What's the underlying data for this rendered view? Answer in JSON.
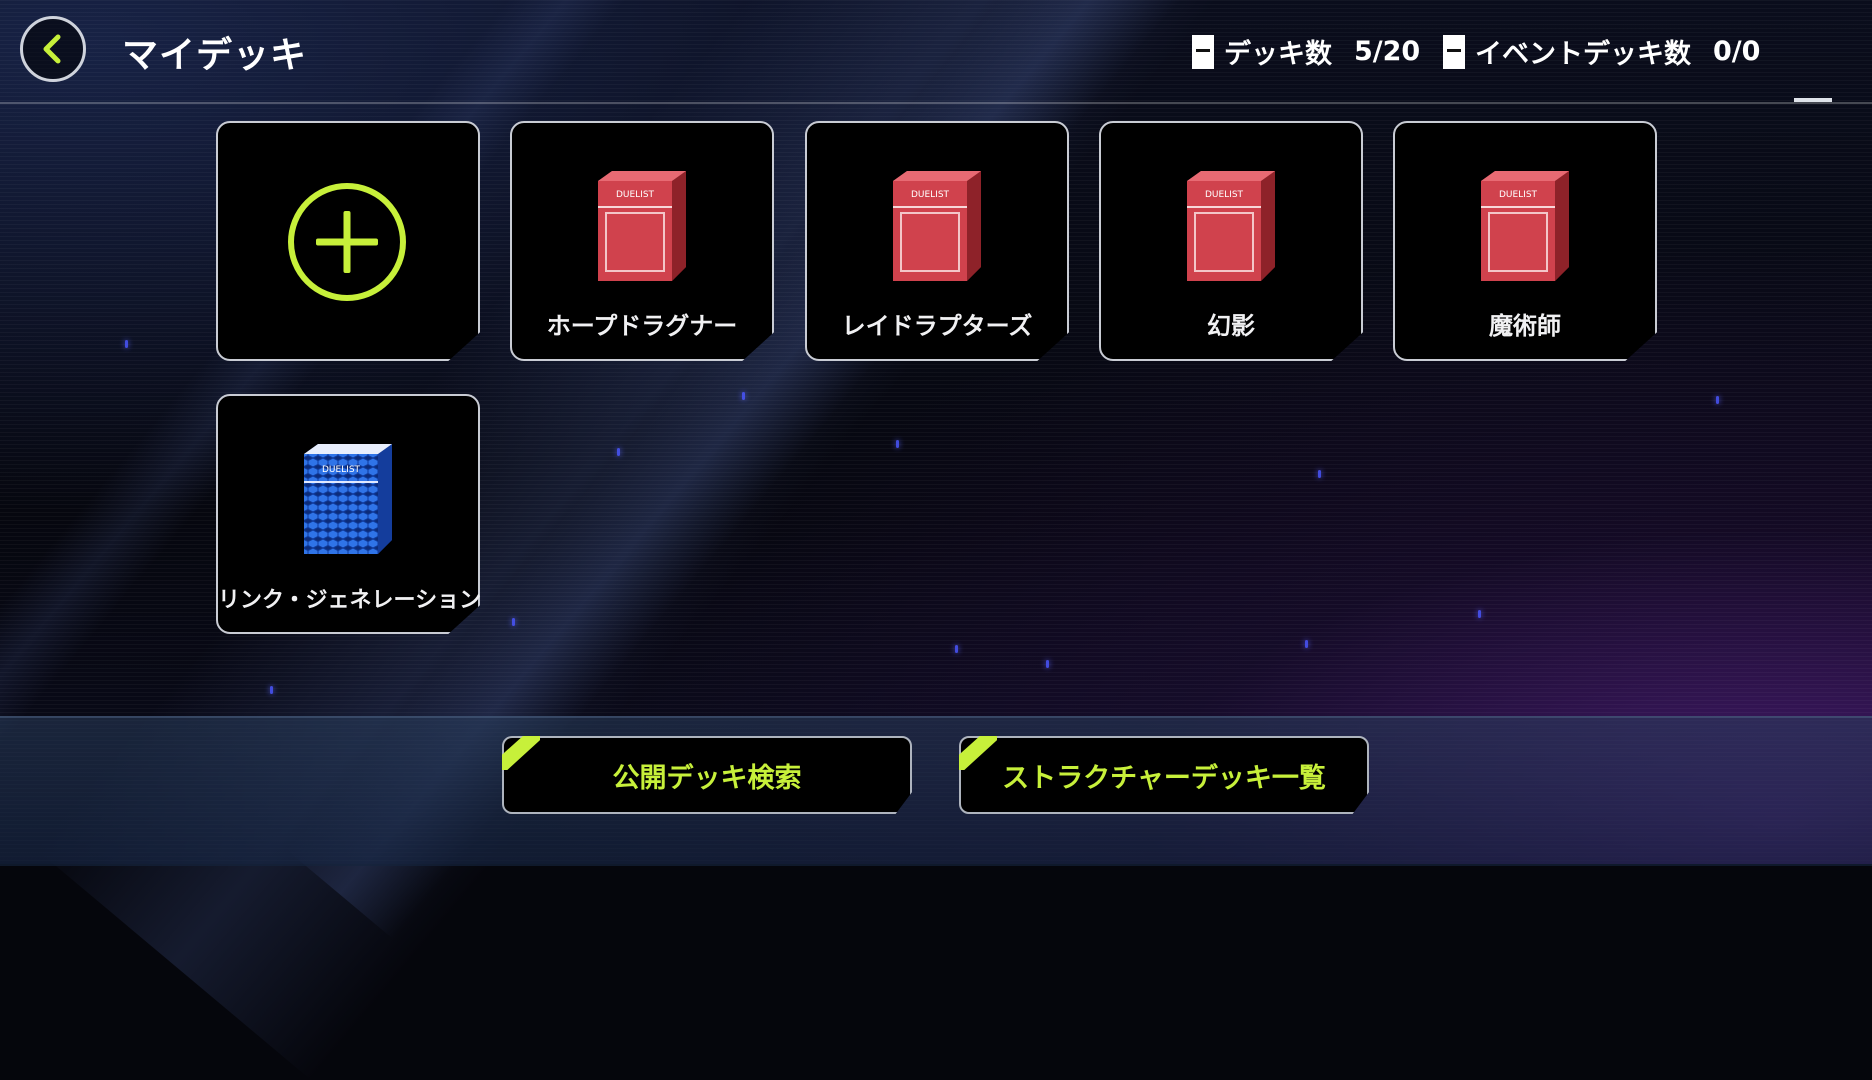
{
  "header": {
    "title": "マイデッキ",
    "deck_count_label": "デッキ数",
    "deck_count_value": "5/20",
    "event_deck_count_label": "イベントデッキ数",
    "event_deck_count_value": "0/0"
  },
  "decks": [
    {
      "name": "ホープドラグナー",
      "box_color": "red"
    },
    {
      "name": "レイドラプターズ",
      "box_color": "red"
    },
    {
      "name": "幻影",
      "box_color": "red"
    },
    {
      "name": "魔術師",
      "box_color": "red"
    },
    {
      "name": "リンク・ジェネレーション",
      "box_color": "blue"
    }
  ],
  "footer": {
    "public_search_label": "公開デッキ検索",
    "structure_list_label": "ストラクチャーデッキ一覧"
  },
  "colors": {
    "accent": "#c7f03a",
    "red_box": "#c8343f",
    "blue_box": "#1e5bd6"
  }
}
